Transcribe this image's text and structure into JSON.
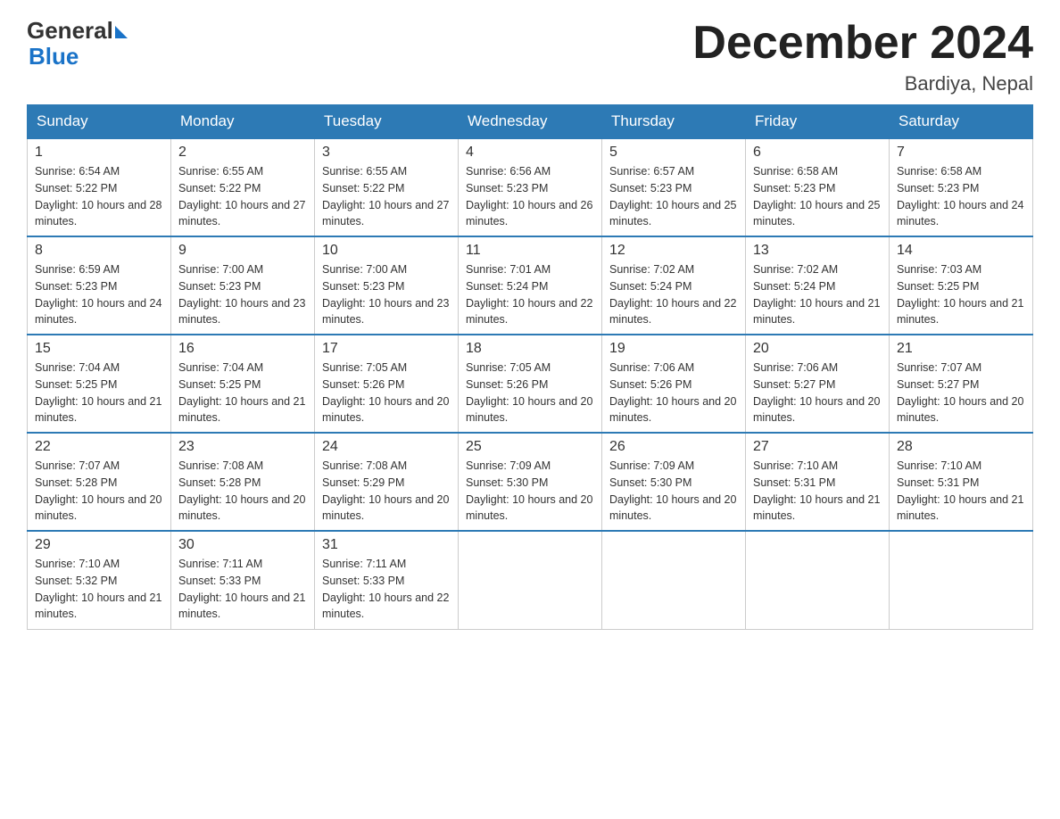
{
  "logo": {
    "general": "General",
    "blue": "Blue"
  },
  "title": "December 2024",
  "location": "Bardiya, Nepal",
  "days_of_week": [
    "Sunday",
    "Monday",
    "Tuesday",
    "Wednesday",
    "Thursday",
    "Friday",
    "Saturday"
  ],
  "weeks": [
    [
      {
        "day": "1",
        "sunrise": "6:54 AM",
        "sunset": "5:22 PM",
        "daylight": "10 hours and 28 minutes."
      },
      {
        "day": "2",
        "sunrise": "6:55 AM",
        "sunset": "5:22 PM",
        "daylight": "10 hours and 27 minutes."
      },
      {
        "day": "3",
        "sunrise": "6:55 AM",
        "sunset": "5:22 PM",
        "daylight": "10 hours and 27 minutes."
      },
      {
        "day": "4",
        "sunrise": "6:56 AM",
        "sunset": "5:23 PM",
        "daylight": "10 hours and 26 minutes."
      },
      {
        "day": "5",
        "sunrise": "6:57 AM",
        "sunset": "5:23 PM",
        "daylight": "10 hours and 25 minutes."
      },
      {
        "day": "6",
        "sunrise": "6:58 AM",
        "sunset": "5:23 PM",
        "daylight": "10 hours and 25 minutes."
      },
      {
        "day": "7",
        "sunrise": "6:58 AM",
        "sunset": "5:23 PM",
        "daylight": "10 hours and 24 minutes."
      }
    ],
    [
      {
        "day": "8",
        "sunrise": "6:59 AM",
        "sunset": "5:23 PM",
        "daylight": "10 hours and 24 minutes."
      },
      {
        "day": "9",
        "sunrise": "7:00 AM",
        "sunset": "5:23 PM",
        "daylight": "10 hours and 23 minutes."
      },
      {
        "day": "10",
        "sunrise": "7:00 AM",
        "sunset": "5:23 PM",
        "daylight": "10 hours and 23 minutes."
      },
      {
        "day": "11",
        "sunrise": "7:01 AM",
        "sunset": "5:24 PM",
        "daylight": "10 hours and 22 minutes."
      },
      {
        "day": "12",
        "sunrise": "7:02 AM",
        "sunset": "5:24 PM",
        "daylight": "10 hours and 22 minutes."
      },
      {
        "day": "13",
        "sunrise": "7:02 AM",
        "sunset": "5:24 PM",
        "daylight": "10 hours and 21 minutes."
      },
      {
        "day": "14",
        "sunrise": "7:03 AM",
        "sunset": "5:25 PM",
        "daylight": "10 hours and 21 minutes."
      }
    ],
    [
      {
        "day": "15",
        "sunrise": "7:04 AM",
        "sunset": "5:25 PM",
        "daylight": "10 hours and 21 minutes."
      },
      {
        "day": "16",
        "sunrise": "7:04 AM",
        "sunset": "5:25 PM",
        "daylight": "10 hours and 21 minutes."
      },
      {
        "day": "17",
        "sunrise": "7:05 AM",
        "sunset": "5:26 PM",
        "daylight": "10 hours and 20 minutes."
      },
      {
        "day": "18",
        "sunrise": "7:05 AM",
        "sunset": "5:26 PM",
        "daylight": "10 hours and 20 minutes."
      },
      {
        "day": "19",
        "sunrise": "7:06 AM",
        "sunset": "5:26 PM",
        "daylight": "10 hours and 20 minutes."
      },
      {
        "day": "20",
        "sunrise": "7:06 AM",
        "sunset": "5:27 PM",
        "daylight": "10 hours and 20 minutes."
      },
      {
        "day": "21",
        "sunrise": "7:07 AM",
        "sunset": "5:27 PM",
        "daylight": "10 hours and 20 minutes."
      }
    ],
    [
      {
        "day": "22",
        "sunrise": "7:07 AM",
        "sunset": "5:28 PM",
        "daylight": "10 hours and 20 minutes."
      },
      {
        "day": "23",
        "sunrise": "7:08 AM",
        "sunset": "5:28 PM",
        "daylight": "10 hours and 20 minutes."
      },
      {
        "day": "24",
        "sunrise": "7:08 AM",
        "sunset": "5:29 PM",
        "daylight": "10 hours and 20 minutes."
      },
      {
        "day": "25",
        "sunrise": "7:09 AM",
        "sunset": "5:30 PM",
        "daylight": "10 hours and 20 minutes."
      },
      {
        "day": "26",
        "sunrise": "7:09 AM",
        "sunset": "5:30 PM",
        "daylight": "10 hours and 20 minutes."
      },
      {
        "day": "27",
        "sunrise": "7:10 AM",
        "sunset": "5:31 PM",
        "daylight": "10 hours and 21 minutes."
      },
      {
        "day": "28",
        "sunrise": "7:10 AM",
        "sunset": "5:31 PM",
        "daylight": "10 hours and 21 minutes."
      }
    ],
    [
      {
        "day": "29",
        "sunrise": "7:10 AM",
        "sunset": "5:32 PM",
        "daylight": "10 hours and 21 minutes."
      },
      {
        "day": "30",
        "sunrise": "7:11 AM",
        "sunset": "5:33 PM",
        "daylight": "10 hours and 21 minutes."
      },
      {
        "day": "31",
        "sunrise": "7:11 AM",
        "sunset": "5:33 PM",
        "daylight": "10 hours and 22 minutes."
      },
      null,
      null,
      null,
      null
    ]
  ],
  "labels": {
    "sunrise": "Sunrise:",
    "sunset": "Sunset:",
    "daylight": "Daylight:"
  }
}
